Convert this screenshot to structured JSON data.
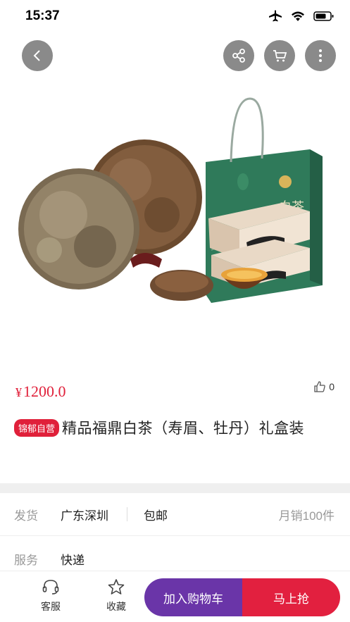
{
  "status": {
    "time": "15:37"
  },
  "nav": {
    "back_icon": "chevron-left-icon",
    "share_icon": "share-icon",
    "cart_icon": "cart-icon",
    "more_icon": "more-vertical-icon"
  },
  "product": {
    "price_symbol": "¥",
    "price": "1200.0",
    "likes": "0",
    "badge": "锦郁自营",
    "title": "精品福鼎白茶（寿眉、牡丹）礼盒装"
  },
  "box_calligraphy": "白茶",
  "shipping": {
    "label": "发货",
    "origin": "广东深圳",
    "free_shipping": "包邮",
    "monthly_sales": "月销100件"
  },
  "service": {
    "label": "服务",
    "value": "快递"
  },
  "bottom_bar": {
    "service_label": "客服",
    "favorite_label": "收藏",
    "add_to_cart": "加入购物车",
    "buy_now": "马上抢"
  },
  "colors": {
    "accent_red": "#e0203a",
    "cart_purple": "#6a35a8",
    "box_green": "#2f7a5a"
  }
}
